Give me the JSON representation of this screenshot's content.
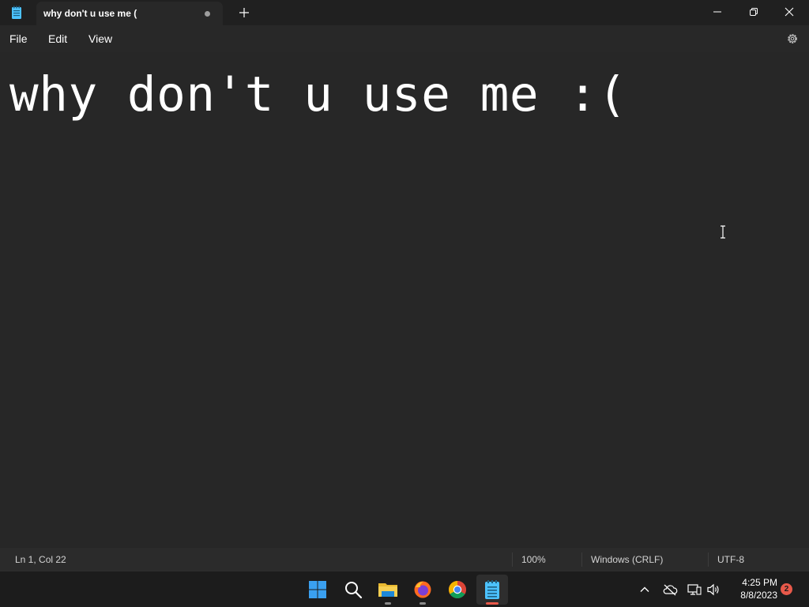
{
  "app": {
    "name": "Notepad",
    "tab_title": "why don't u use me (",
    "tab_unsaved": true
  },
  "menu": {
    "file_label": "File",
    "edit_label": "Edit",
    "view_label": "View"
  },
  "editor": {
    "content": "why don't u use me :("
  },
  "status": {
    "position": "Ln 1, Col 22",
    "zoom": "100%",
    "line_ending": "Windows (CRLF)",
    "encoding": "UTF-8"
  },
  "taskbar": {
    "apps": [
      {
        "name": "start-icon"
      },
      {
        "name": "search-icon"
      },
      {
        "name": "file-explorer-icon",
        "running": true
      },
      {
        "name": "firefox-icon",
        "running": true
      },
      {
        "name": "chrome-icon"
      },
      {
        "name": "notepad-icon",
        "running": true,
        "active": true
      }
    ],
    "time": "4:25 PM",
    "date": "8/8/2023",
    "notification_count": "2"
  },
  "colors": {
    "background": "#272727",
    "titlebar": "#202020",
    "taskbar": "#1c1c1c",
    "accent": "#4cc2ff",
    "badge": "#e8594a"
  }
}
